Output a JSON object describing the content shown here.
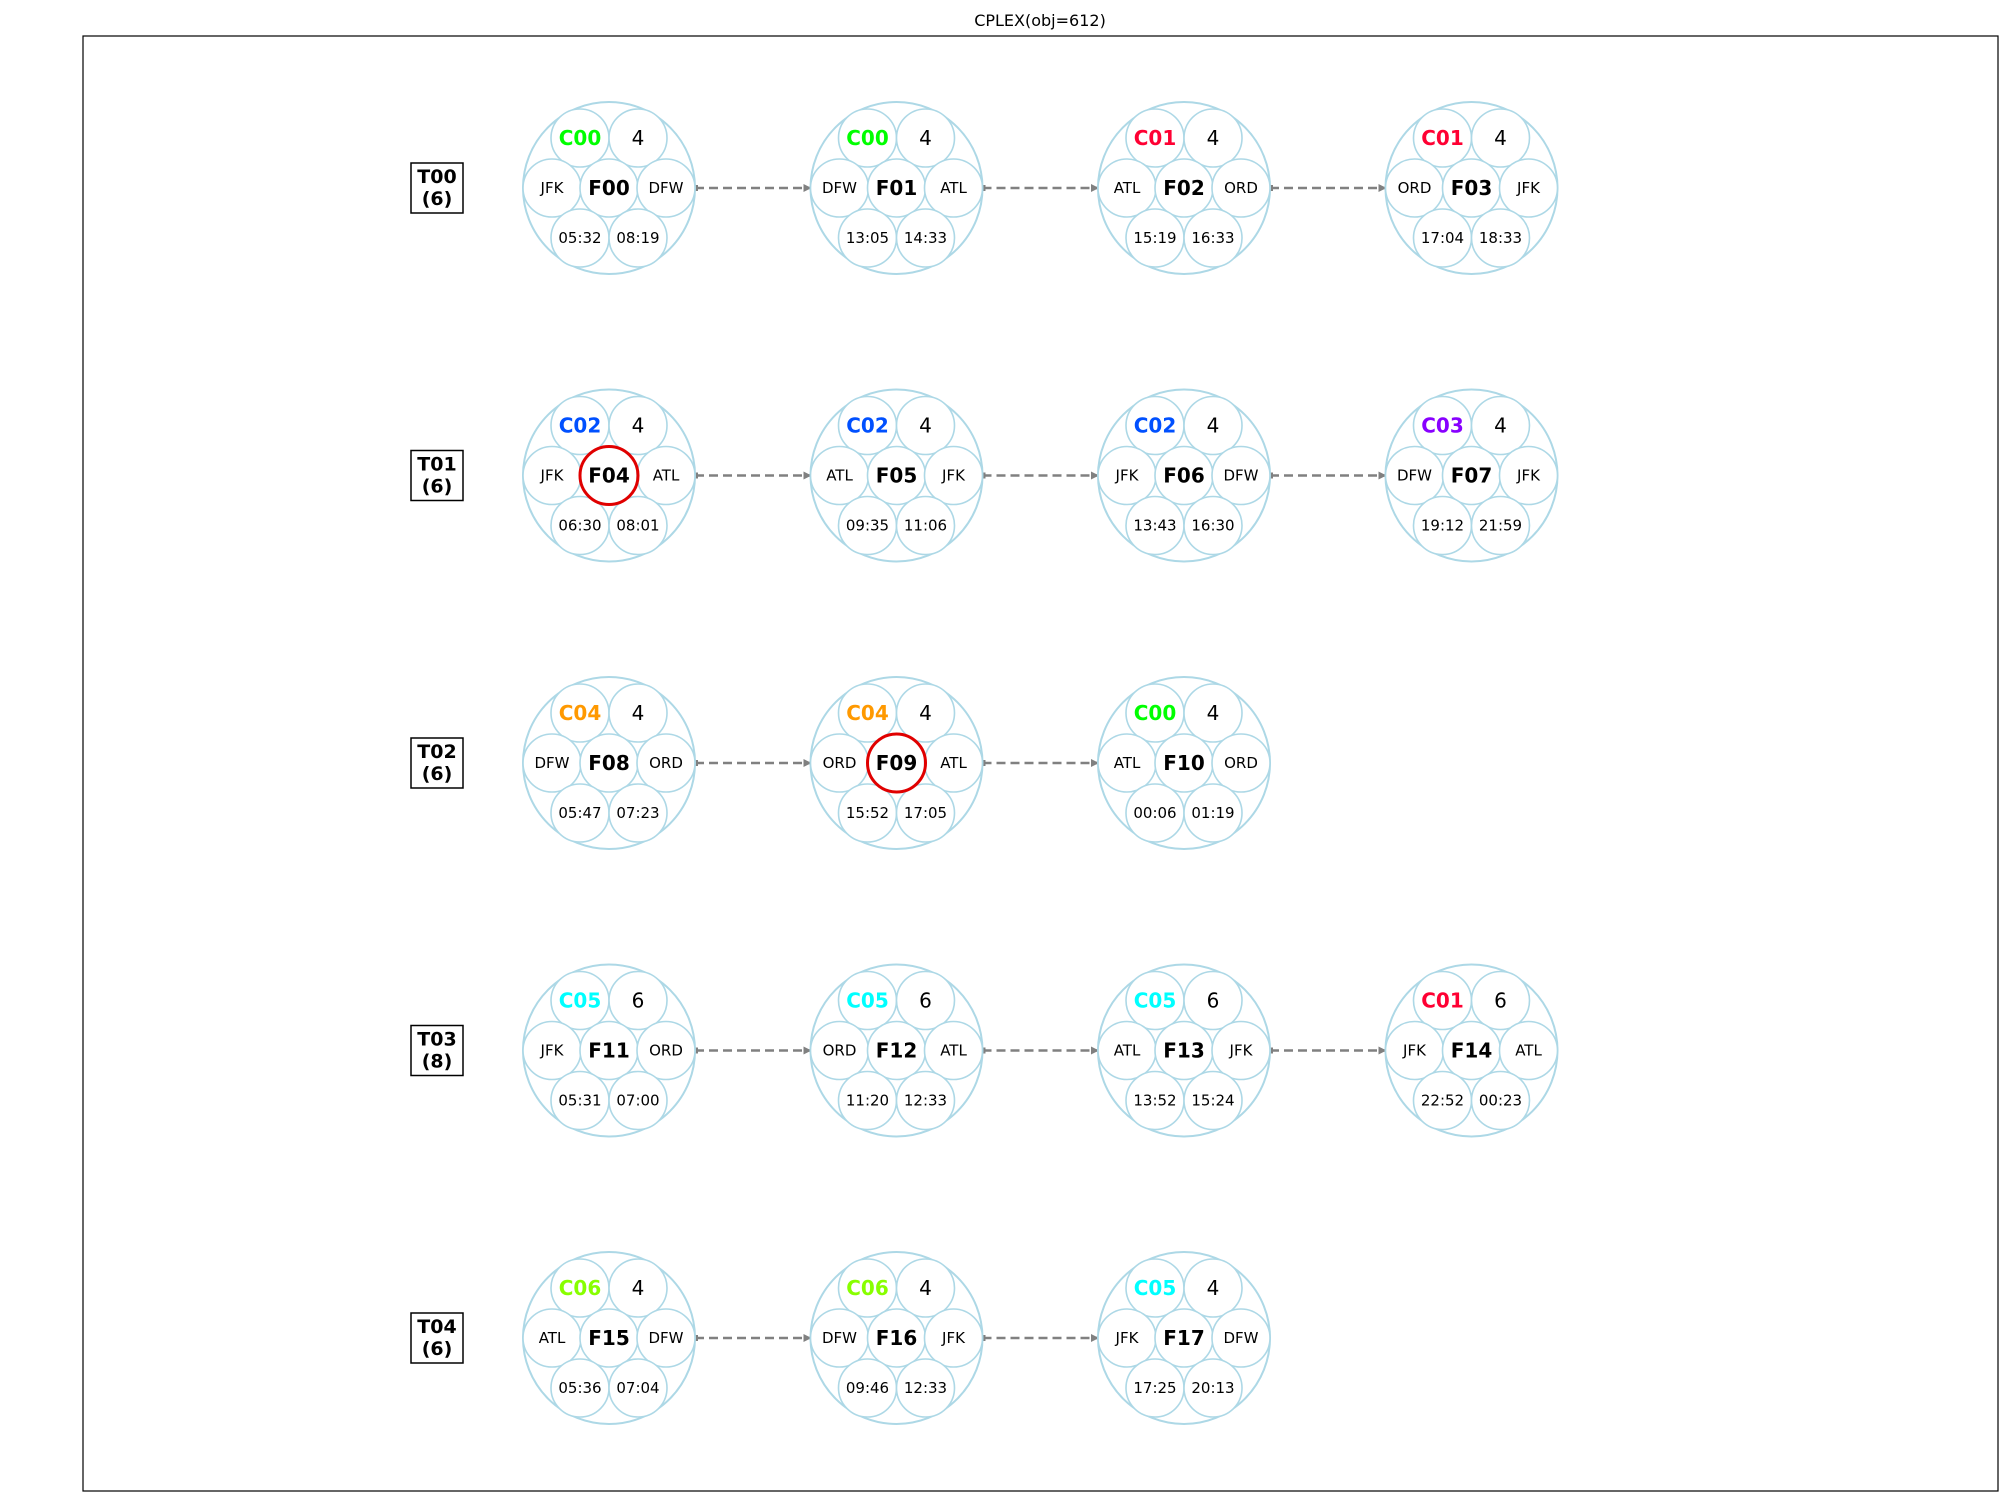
{
  "title": "CPLEX(obj=612)",
  "colors": {
    "node_stroke": "#add8e6",
    "arrow": "#808080",
    "highlight": "#e00000",
    "frame": "#000000"
  },
  "rows": [
    {
      "label": "T00",
      "count": "(6)",
      "flights": [
        {
          "id": "F00",
          "crew": "C00",
          "crew_color": "#00ff00",
          "capacity": "4",
          "origin": "JFK",
          "dest": "DFW",
          "dep": "05:32",
          "arr": "08:19",
          "highlight": false
        },
        {
          "id": "F01",
          "crew": "C00",
          "crew_color": "#00ff00",
          "capacity": "4",
          "origin": "DFW",
          "dest": "ATL",
          "dep": "13:05",
          "arr": "14:33",
          "highlight": false
        },
        {
          "id": "F02",
          "crew": "C01",
          "crew_color": "#ff0033",
          "capacity": "4",
          "origin": "ATL",
          "dest": "ORD",
          "dep": "15:19",
          "arr": "16:33",
          "highlight": false
        },
        {
          "id": "F03",
          "crew": "C01",
          "crew_color": "#ff0033",
          "capacity": "4",
          "origin": "ORD",
          "dest": "JFK",
          "dep": "17:04",
          "arr": "18:33",
          "highlight": false
        }
      ]
    },
    {
      "label": "T01",
      "count": "(6)",
      "flights": [
        {
          "id": "F04",
          "crew": "C02",
          "crew_color": "#0050ff",
          "capacity": "4",
          "origin": "JFK",
          "dest": "ATL",
          "dep": "06:30",
          "arr": "08:01",
          "highlight": true
        },
        {
          "id": "F05",
          "crew": "C02",
          "crew_color": "#0050ff",
          "capacity": "4",
          "origin": "ATL",
          "dest": "JFK",
          "dep": "09:35",
          "arr": "11:06",
          "highlight": false
        },
        {
          "id": "F06",
          "crew": "C02",
          "crew_color": "#0050ff",
          "capacity": "4",
          "origin": "JFK",
          "dest": "DFW",
          "dep": "13:43",
          "arr": "16:30",
          "highlight": false
        },
        {
          "id": "F07",
          "crew": "C03",
          "crew_color": "#8800ff",
          "capacity": "4",
          "origin": "DFW",
          "dest": "JFK",
          "dep": "19:12",
          "arr": "21:59",
          "highlight": false
        }
      ]
    },
    {
      "label": "T02",
      "count": "(6)",
      "flights": [
        {
          "id": "F08",
          "crew": "C04",
          "crew_color": "#ff9900",
          "capacity": "4",
          "origin": "DFW",
          "dest": "ORD",
          "dep": "05:47",
          "arr": "07:23",
          "highlight": false
        },
        {
          "id": "F09",
          "crew": "C04",
          "crew_color": "#ff9900",
          "capacity": "4",
          "origin": "ORD",
          "dest": "ATL",
          "dep": "15:52",
          "arr": "17:05",
          "highlight": true
        },
        {
          "id": "F10",
          "crew": "C00",
          "crew_color": "#00ff00",
          "capacity": "4",
          "origin": "ATL",
          "dest": "ORD",
          "dep": "00:06",
          "arr": "01:19",
          "highlight": false
        }
      ]
    },
    {
      "label": "T03",
      "count": "(8)",
      "flights": [
        {
          "id": "F11",
          "crew": "C05",
          "crew_color": "#00ffff",
          "capacity": "6",
          "origin": "JFK",
          "dest": "ORD",
          "dep": "05:31",
          "arr": "07:00",
          "highlight": false
        },
        {
          "id": "F12",
          "crew": "C05",
          "crew_color": "#00ffff",
          "capacity": "6",
          "origin": "ORD",
          "dest": "ATL",
          "dep": "11:20",
          "arr": "12:33",
          "highlight": false
        },
        {
          "id": "F13",
          "crew": "C05",
          "crew_color": "#00ffff",
          "capacity": "6",
          "origin": "ATL",
          "dest": "JFK",
          "dep": "13:52",
          "arr": "15:24",
          "highlight": false
        },
        {
          "id": "F14",
          "crew": "C01",
          "crew_color": "#ff0033",
          "capacity": "6",
          "origin": "JFK",
          "dest": "ATL",
          "dep": "22:52",
          "arr": "00:23",
          "highlight": false
        }
      ]
    },
    {
      "label": "T04",
      "count": "(6)",
      "flights": [
        {
          "id": "F15",
          "crew": "C06",
          "crew_color": "#88ff00",
          "capacity": "4",
          "origin": "ATL",
          "dest": "DFW",
          "dep": "05:36",
          "arr": "07:04",
          "highlight": false
        },
        {
          "id": "F16",
          "crew": "C06",
          "crew_color": "#88ff00",
          "capacity": "4",
          "origin": "DFW",
          "dest": "JFK",
          "dep": "09:46",
          "arr": "12:33",
          "highlight": false
        },
        {
          "id": "F17",
          "crew": "C05",
          "crew_color": "#00ffff",
          "capacity": "4",
          "origin": "JFK",
          "dest": "DFW",
          "dep": "17:25",
          "arr": "20:13",
          "highlight": false
        }
      ]
    }
  ]
}
